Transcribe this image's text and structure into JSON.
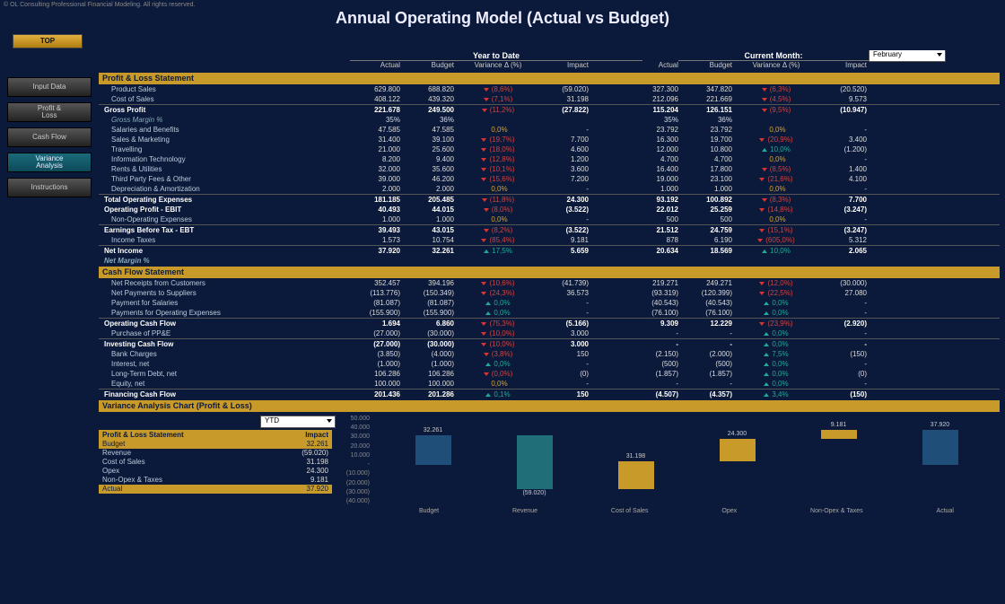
{
  "copyright": "© OL Consulting Professional Financial Modeling. All rights reserved.",
  "title": "Annual Operating Model (Actual vs Budget)",
  "top_button": "TOP",
  "nav": [
    {
      "label": "Input Data",
      "active": false,
      "two": false
    },
    {
      "label": "Profit & Loss",
      "active": false,
      "two": true
    },
    {
      "label": "Cash Flow",
      "active": false,
      "two": false
    },
    {
      "label": "Variance Analysis",
      "active": true,
      "two": true
    },
    {
      "label": "Instructions",
      "active": false,
      "two": false
    }
  ],
  "groups": {
    "ytd": "Year to Date",
    "month": "Current Month:",
    "month_selected": "February"
  },
  "columns": [
    "Actual",
    "Budget",
    "Variance Δ (%)",
    "Impact"
  ],
  "sections": [
    {
      "title": "Profit & Loss Statement",
      "rows": [
        {
          "l": "Product Sales",
          "ytd": {
            "a": "629.800",
            "b": "688.820",
            "d": "down",
            "v": "(8,6%)",
            "i": "(59.020)"
          },
          "m": {
            "a": "327.300",
            "b": "347.820",
            "d": "down",
            "v": "(6,3%)",
            "i": "(20.520)"
          }
        },
        {
          "l": "Cost of Sales",
          "ytd": {
            "a": "408.122",
            "b": "439.320",
            "d": "down",
            "v": "(7,1%)",
            "i": "31.198"
          },
          "m": {
            "a": "212.096",
            "b": "221.669",
            "d": "down",
            "v": "(4,5%)",
            "i": "9.573"
          }
        },
        {
          "l": "Gross Profit",
          "bold": true,
          "bt": true,
          "ytd": {
            "a": "221.678",
            "b": "249.500",
            "d": "down",
            "v": "(11,2%)",
            "i": "(27.822)"
          },
          "m": {
            "a": "115.204",
            "b": "126.151",
            "d": "down",
            "v": "(9,5%)",
            "i": "(10.947)"
          }
        },
        {
          "l": "Gross Margin %",
          "ital": true,
          "ytd": {
            "a": "35%",
            "b": "36%",
            "d": "",
            "v": "",
            "i": ""
          },
          "m": {
            "a": "35%",
            "b": "36%",
            "d": "",
            "v": "",
            "i": ""
          }
        },
        {
          "l": "Salaries and Benefits",
          "ytd": {
            "a": "47.585",
            "b": "47.585",
            "d": "flat",
            "v": "0,0%",
            "i": "-"
          },
          "m": {
            "a": "23.792",
            "b": "23.792",
            "d": "flat",
            "v": "0,0%",
            "i": "-"
          }
        },
        {
          "l": "Sales & Marketing",
          "ytd": {
            "a": "31.400",
            "b": "39.100",
            "d": "down",
            "v": "(19,7%)",
            "i": "7.700"
          },
          "m": {
            "a": "16.300",
            "b": "19.700",
            "d": "down",
            "v": "(20,9%)",
            "i": "3.400"
          }
        },
        {
          "l": "Travelling",
          "ytd": {
            "a": "21.000",
            "b": "25.600",
            "d": "down",
            "v": "(18,0%)",
            "i": "4.600"
          },
          "m": {
            "a": "12.000",
            "b": "10.800",
            "d": "up",
            "v": "10,0%",
            "i": "(1.200)"
          }
        },
        {
          "l": "Information Technology",
          "ytd": {
            "a": "8.200",
            "b": "9.400",
            "d": "down",
            "v": "(12,8%)",
            "i": "1.200"
          },
          "m": {
            "a": "4.700",
            "b": "4.700",
            "d": "flat",
            "v": "0,0%",
            "i": "-"
          }
        },
        {
          "l": "Rents & Utilities",
          "ytd": {
            "a": "32.000",
            "b": "35.600",
            "d": "down",
            "v": "(10,1%)",
            "i": "3.600"
          },
          "m": {
            "a": "16.400",
            "b": "17.800",
            "d": "down",
            "v": "(8,5%)",
            "i": "1.400"
          }
        },
        {
          "l": "Third Party Fees & Other",
          "ytd": {
            "a": "39.000",
            "b": "46.200",
            "d": "down",
            "v": "(15,6%)",
            "i": "7.200"
          },
          "m": {
            "a": "19.000",
            "b": "23.100",
            "d": "down",
            "v": "(21,6%)",
            "i": "4.100"
          }
        },
        {
          "l": "Depreciation & Amortization",
          "ytd": {
            "a": "2.000",
            "b": "2.000",
            "d": "flat",
            "v": "0,0%",
            "i": "-"
          },
          "m": {
            "a": "1.000",
            "b": "1.000",
            "d": "flat",
            "v": "0,0%",
            "i": "-"
          }
        },
        {
          "l": "Total Operating Expenses",
          "bold": true,
          "bt": true,
          "ytd": {
            "a": "181.185",
            "b": "205.485",
            "d": "down",
            "v": "(11,8%)",
            "i": "24.300"
          },
          "m": {
            "a": "93.192",
            "b": "100.892",
            "d": "down",
            "v": "(8,3%)",
            "i": "7.700"
          }
        },
        {
          "l": "Operating Profit - EBIT",
          "bold": true,
          "ytd": {
            "a": "40.493",
            "b": "44.015",
            "d": "down",
            "v": "(8,0%)",
            "i": "(3.522)"
          },
          "m": {
            "a": "22.012",
            "b": "25.259",
            "d": "down",
            "v": "(14,8%)",
            "i": "(3.247)"
          }
        },
        {
          "l": "Non-Operating Expenses",
          "ytd": {
            "a": "1.000",
            "b": "1.000",
            "d": "flat",
            "v": "0,0%",
            "i": "-"
          },
          "m": {
            "a": "500",
            "b": "500",
            "d": "flat",
            "v": "0,0%",
            "i": "-"
          }
        },
        {
          "l": "Earnings Before Tax - EBT",
          "bold": true,
          "bt": true,
          "ytd": {
            "a": "39.493",
            "b": "43.015",
            "d": "down",
            "v": "(8,2%)",
            "i": "(3.522)"
          },
          "m": {
            "a": "21.512",
            "b": "24.759",
            "d": "down",
            "v": "(15,1%)",
            "i": "(3.247)"
          }
        },
        {
          "l": "Income Taxes",
          "ytd": {
            "a": "1.573",
            "b": "10.754",
            "d": "down",
            "v": "(85,4%)",
            "i": "9.181"
          },
          "m": {
            "a": "878",
            "b": "6.190",
            "d": "down",
            "v": "(605,0%)",
            "i": "5.312"
          }
        },
        {
          "l": "Net Income",
          "bold": true,
          "bt": true,
          "ytd": {
            "a": "37.920",
            "b": "32.261",
            "d": "up",
            "v": "17,5%",
            "i": "5.659"
          },
          "m": {
            "a": "20.634",
            "b": "18.569",
            "d": "up",
            "v": "10,0%",
            "i": "2.065"
          }
        },
        {
          "l": "Net Margin %",
          "ital": true,
          "bold": true,
          "ytd": {
            "a": "",
            "b": "",
            "d": "",
            "v": "",
            "i": ""
          },
          "m": {
            "a": "",
            "b": "",
            "d": "",
            "v": "",
            "i": ""
          }
        }
      ]
    },
    {
      "title": "Cash Flow Statement",
      "rows": [
        {
          "l": "Net Receipts from Customers",
          "ytd": {
            "a": "352.457",
            "b": "394.196",
            "d": "down",
            "v": "(10,6%)",
            "i": "(41.739)"
          },
          "m": {
            "a": "219.271",
            "b": "249.271",
            "d": "down",
            "v": "(12,0%)",
            "i": "(30.000)"
          }
        },
        {
          "l": "Net Payments to Suppliers",
          "ytd": {
            "a": "(113.776)",
            "b": "(150.349)",
            "d": "down",
            "v": "(24,3%)",
            "i": "36.573"
          },
          "m": {
            "a": "(93.319)",
            "b": "(120.399)",
            "d": "down",
            "v": "(22,5%)",
            "i": "27.080"
          }
        },
        {
          "l": "Payment for Salaries",
          "ytd": {
            "a": "(81.087)",
            "b": "(81.087)",
            "d": "up",
            "v": "0,0%",
            "i": "-"
          },
          "m": {
            "a": "(40.543)",
            "b": "(40.543)",
            "d": "up",
            "v": "0,0%",
            "i": "-"
          }
        },
        {
          "l": "Payments for Operating Expenses",
          "ytd": {
            "a": "(155.900)",
            "b": "(155.900)",
            "d": "up",
            "v": "0,0%",
            "i": "-"
          },
          "m": {
            "a": "(76.100)",
            "b": "(76.100)",
            "d": "up",
            "v": "0,0%",
            "i": "-"
          }
        },
        {
          "l": "Operating Cash Flow",
          "bold": true,
          "bt": true,
          "ytd": {
            "a": "1.694",
            "b": "6.860",
            "d": "down",
            "v": "(75,3%)",
            "i": "(5.166)"
          },
          "m": {
            "a": "9.309",
            "b": "12.229",
            "d": "down",
            "v": "(23,9%)",
            "i": "(2.920)"
          }
        },
        {
          "l": "Purchase of PP&E",
          "ytd": {
            "a": "(27.000)",
            "b": "(30.000)",
            "d": "down",
            "v": "(10,0%)",
            "i": "3.000"
          },
          "m": {
            "a": "-",
            "b": "-",
            "d": "up",
            "v": "0,0%",
            "i": "-"
          }
        },
        {
          "l": "Investing Cash Flow",
          "bold": true,
          "bt": true,
          "ytd": {
            "a": "(27.000)",
            "b": "(30.000)",
            "d": "down",
            "v": "(10,0%)",
            "i": "3.000"
          },
          "m": {
            "a": "-",
            "b": "-",
            "d": "up",
            "v": "0,0%",
            "i": "-"
          }
        },
        {
          "l": "Bank Charges",
          "ytd": {
            "a": "(3.850)",
            "b": "(4.000)",
            "d": "down",
            "v": "(3,8%)",
            "i": "150"
          },
          "m": {
            "a": "(2.150)",
            "b": "(2.000)",
            "d": "up",
            "v": "7,5%",
            "i": "(150)"
          }
        },
        {
          "l": "Interest, net",
          "ytd": {
            "a": "(1.000)",
            "b": "(1.000)",
            "d": "up",
            "v": "0,0%",
            "i": "-"
          },
          "m": {
            "a": "(500)",
            "b": "(500)",
            "d": "up",
            "v": "0,0%",
            "i": "-"
          }
        },
        {
          "l": "Long-Term Debt, net",
          "ytd": {
            "a": "106.286",
            "b": "106.286",
            "d": "down",
            "v": "(0,0%)",
            "i": "(0)"
          },
          "m": {
            "a": "(1.857)",
            "b": "(1.857)",
            "d": "up",
            "v": "0,0%",
            "i": "(0)"
          }
        },
        {
          "l": "Equity, net",
          "ytd": {
            "a": "100.000",
            "b": "100.000",
            "d": "flat",
            "v": "0,0%",
            "i": "-"
          },
          "m": {
            "a": "-",
            "b": "-",
            "d": "up",
            "v": "0,0%",
            "i": "-"
          }
        },
        {
          "l": "Financing Cash Flow",
          "bold": true,
          "bt": true,
          "ytd": {
            "a": "201.436",
            "b": "201.286",
            "d": "up",
            "v": "0,1%",
            "i": "150"
          },
          "m": {
            "a": "(4.507)",
            "b": "(4.357)",
            "d": "up",
            "v": "3,4%",
            "i": "(150)"
          }
        }
      ]
    }
  ],
  "chart_section": "Variance Analysis Chart (Profit & Loss)",
  "impact": {
    "period": "YTD",
    "head_label": "Profit & Loss Statement",
    "head_value": "Impact",
    "rows": [
      {
        "l": "Budget",
        "v": "32.261",
        "hl": true
      },
      {
        "l": "Revenue",
        "v": "(59.020)"
      },
      {
        "l": "Cost of Sales",
        "v": "31.198"
      },
      {
        "l": "Opex",
        "v": "24.300"
      },
      {
        "l": "Non-Opex & Taxes",
        "v": "9.181"
      },
      {
        "l": "Actual",
        "v": "37.920",
        "hl": true
      }
    ]
  },
  "chart_data": {
    "type": "bar",
    "title": "",
    "xlabel": "",
    "ylabel": "",
    "ylim": [
      -40000,
      50000
    ],
    "yticks": [
      50000,
      40000,
      30000,
      20000,
      10000,
      0,
      -10000,
      -20000,
      -30000,
      -40000
    ],
    "ytick_labels": [
      "50.000",
      "40.000",
      "30.000",
      "20.000",
      "10.000",
      "-",
      "(10.000)",
      "(20.000)",
      "(30.000)",
      "(40.000)"
    ],
    "categories": [
      "Budget",
      "Revenue",
      "Cost of Sales",
      "Opex",
      "Non-Opex & Taxes",
      "Actual"
    ],
    "series": [
      {
        "name": "waterfall",
        "bars": [
          {
            "base": 0,
            "value": 32261,
            "label": "32.261",
            "color": "#1f4e78"
          },
          {
            "base": 32261,
            "value": -59020,
            "label": "(59.020)",
            "color": "#1f6e78"
          },
          {
            "base": -26759,
            "value": 31198,
            "label": "31.198",
            "color": "#c79a2a"
          },
          {
            "base": 4439,
            "value": 24300,
            "label": "24.300",
            "color": "#c79a2a"
          },
          {
            "base": 28739,
            "value": 9181,
            "label": "9.181",
            "color": "#c79a2a"
          },
          {
            "base": 0,
            "value": 37920,
            "label": "37.920",
            "color": "#1f4e78"
          }
        ]
      }
    ]
  }
}
